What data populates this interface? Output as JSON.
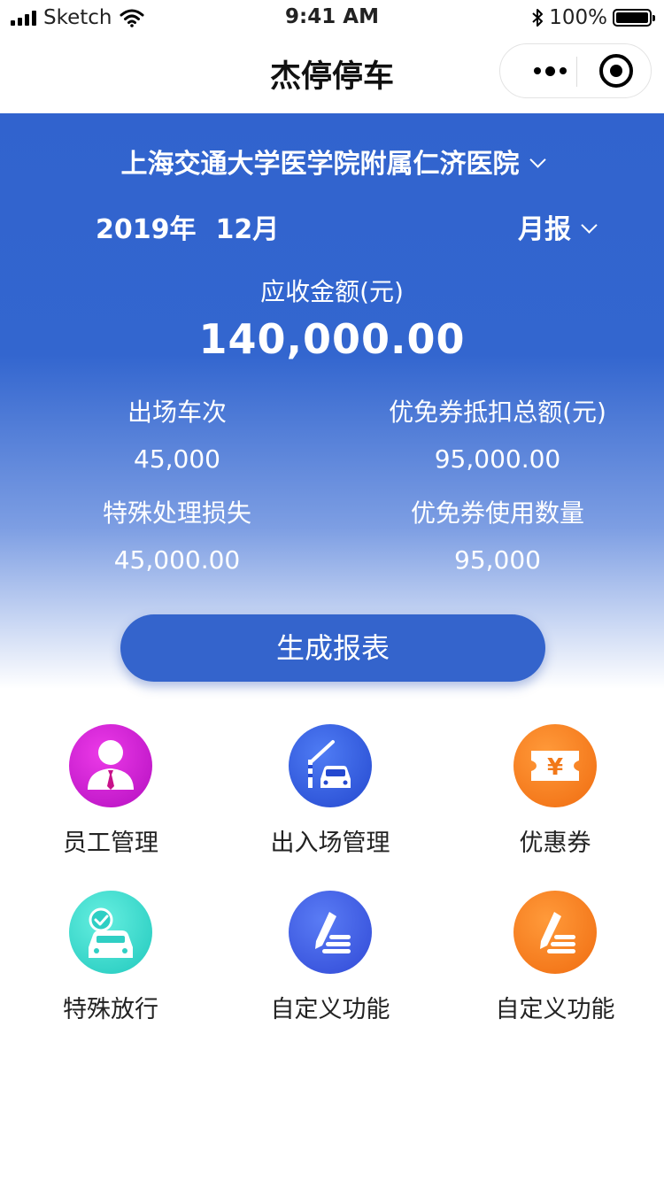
{
  "status_bar": {
    "carrier": "Sketch",
    "time": "9:41 AM",
    "battery": "100%"
  },
  "nav": {
    "title": "杰停停车"
  },
  "report": {
    "hospital": "上海交通大学医学院附属仁济医院",
    "year": "2019年",
    "month": "12月",
    "period": "月报",
    "amount_label": "应收金额(元)",
    "amount_value": "140,000.00",
    "stats": [
      {
        "label": "出场车次",
        "value": "45,000"
      },
      {
        "label": "优免券抵扣总额(元)",
        "value": "95,000.00"
      },
      {
        "label": "特殊处理损失",
        "value": "45,000.00"
      },
      {
        "label": "优免券使用数量",
        "value": "95,000"
      }
    ],
    "generate_button": "生成报表"
  },
  "grid": [
    {
      "label": "员工管理",
      "icon": "employee-icon",
      "color": "#d21fd6"
    },
    {
      "label": "出入场管理",
      "icon": "gate-car-icon",
      "color": "#3358e0"
    },
    {
      "label": "优惠券",
      "icon": "coupon-yuan-icon",
      "color": "#f7821f"
    },
    {
      "label": "特殊放行",
      "icon": "car-check-icon",
      "color": "#3bd9cf"
    },
    {
      "label": "自定义功能",
      "icon": "pen-list-icon",
      "color": "#3d5fe6"
    },
    {
      "label": "自定义功能",
      "icon": "pen-list-icon",
      "color": "#f7821f"
    }
  ],
  "colors": {
    "primary": "#3464cc",
    "hero_top": "#3163ce"
  }
}
